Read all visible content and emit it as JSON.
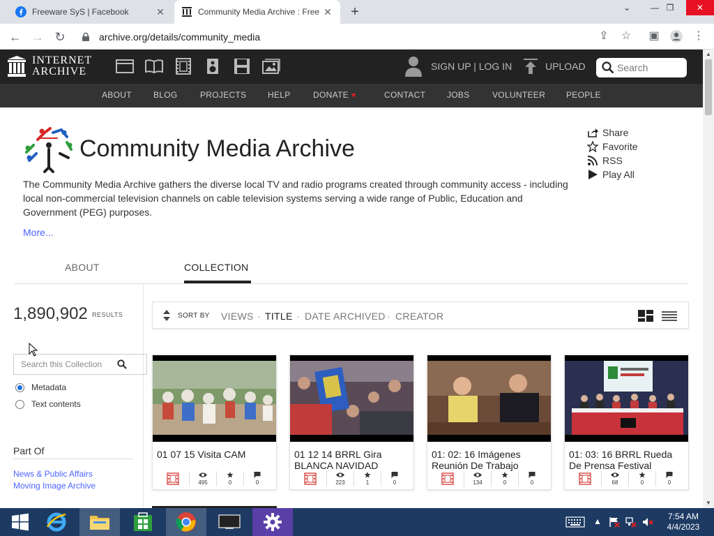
{
  "browser": {
    "tabs": [
      {
        "title": "Freeware SyS | Facebook",
        "favicon": "facebook-icon"
      },
      {
        "title": "Community Media Archive : Free",
        "favicon": "internet-archive-icon"
      }
    ],
    "url": "archive.org/details/community_media"
  },
  "ia_nav": {
    "logo_line1": "INTERNET",
    "logo_line2": "ARCHIVE",
    "signup": "SIGN UP | LOG IN",
    "upload": "UPLOAD",
    "search_placeholder": "Search",
    "media_icons": [
      "web-icon",
      "texts-icon",
      "video-icon",
      "audio-icon",
      "software-icon",
      "images-icon"
    ],
    "subnav": [
      "ABOUT",
      "BLOG",
      "PROJECTS",
      "HELP",
      "DONATE",
      "CONTACT",
      "JOBS",
      "VOLUNTEER",
      "PEOPLE"
    ]
  },
  "collection": {
    "title": "Community Media Archive",
    "description": "The Community Media Archive gathers the diverse local TV and radio programs created through community access - including local non-commercial television channels on cable television systems serving a wide range of Public, Education and Government (PEG) purposes.",
    "more": "More...",
    "actions": [
      "Share",
      "Favorite",
      "RSS",
      "Play All"
    ],
    "tabs": {
      "about": "ABOUT",
      "collection": "COLLECTION"
    }
  },
  "sidebar": {
    "results_count": "1,890,902",
    "results_label": "RESULTS",
    "search_placeholder": "Search this Collection",
    "radio_metadata": "Metadata",
    "radio_text": "Text contents",
    "part_of_title": "Part Of",
    "part_of_links": [
      "News & Public Affairs",
      "Moving Image Archive"
    ]
  },
  "sortbar": {
    "label": "SORT BY",
    "options": [
      "VIEWS",
      "TITLE",
      "DATE ARCHIVED",
      "CREATOR"
    ],
    "active": "TITLE"
  },
  "items": [
    {
      "title": "01 07 15 Visita CAM",
      "views": "495",
      "favorites": "0",
      "reviews": "0"
    },
    {
      "title": "01 12 14 BRRL Gira BLANCA NAVIDAD",
      "views": "223",
      "favorites": "1",
      "reviews": "0"
    },
    {
      "title": "01: 02: 16 Imágenes Reunión De Trabajo",
      "views": "134",
      "favorites": "0",
      "reviews": "0"
    },
    {
      "title": "01: 03: 16 BRRL Rueda De Prensa Festival",
      "views": "68",
      "favorites": "0",
      "reviews": "0"
    }
  ],
  "taskbar": {
    "clock_time": "7:54 AM",
    "clock_date": "4/4/2023"
  },
  "colors": {
    "ia_dark": "#222222",
    "ia_subnav": "#333333",
    "link_blue": "#4b64ff",
    "taskbar": "#1d3a63"
  }
}
